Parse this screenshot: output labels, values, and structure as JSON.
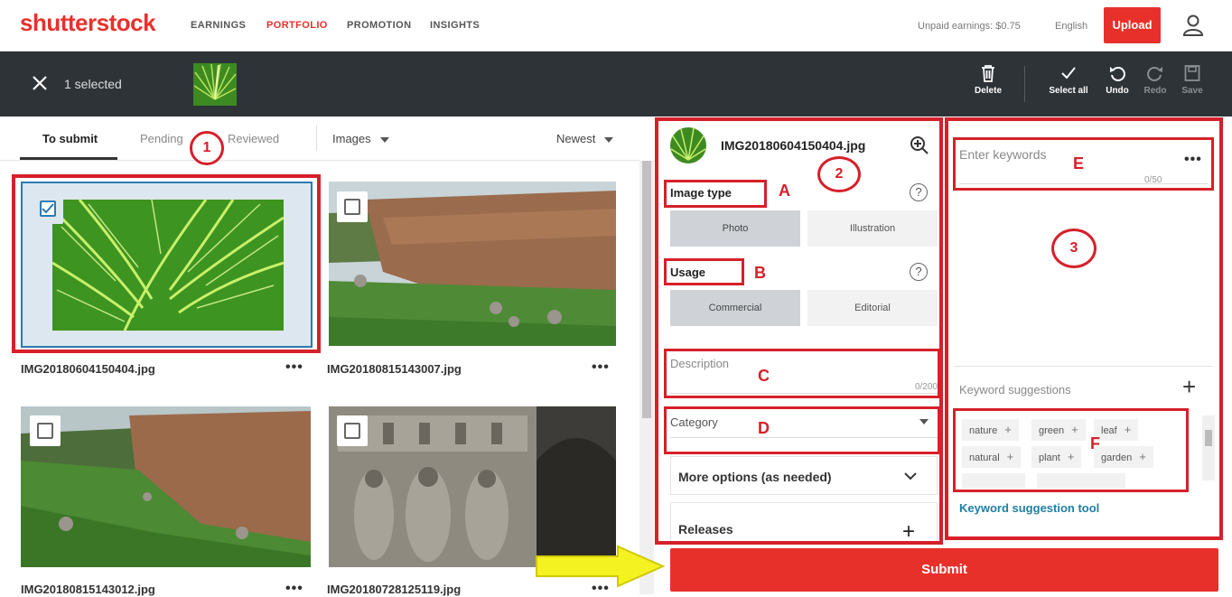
{
  "colors": {
    "brand": "#e8302b",
    "annotation": "#d6202a",
    "dark_bar": "#2e3338",
    "arrow": "#f5f222",
    "link": "#1f7fa4"
  },
  "nav": {
    "logo": "shutterstock",
    "links": [
      "EARNINGS",
      "PORTFOLIO",
      "PROMOTION",
      "INSIGHTS"
    ],
    "active": "PORTFOLIO",
    "unpaid": "Unpaid earnings: $0.75",
    "language": "English",
    "upload": "Upload"
  },
  "selection": {
    "count_label": "1 selected",
    "tools": {
      "delete": "Delete",
      "select_all": "Select all",
      "undo": "Undo",
      "redo": "Redo",
      "save": "Save"
    }
  },
  "tabs": {
    "items": [
      "To submit",
      "Pending",
      "Reviewed"
    ],
    "active": "To submit",
    "media_filter": "Images",
    "sort": "Newest"
  },
  "images": [
    {
      "filename": "IMG20180604150404.jpg",
      "selected": true
    },
    {
      "filename": "IMG20180815143007.jpg",
      "selected": false
    },
    {
      "filename": "IMG20180815143012.jpg",
      "selected": false
    },
    {
      "filename": "IMG20180728125119.jpg",
      "selected": false
    }
  ],
  "more_icon": "•••",
  "detail": {
    "filename": "IMG20180604150404.jpg",
    "image_type_label": "Image type",
    "image_type_options": [
      "Photo",
      "Illustration"
    ],
    "image_type_selected": "Photo",
    "usage_label": "Usage",
    "usage_options": [
      "Commercial",
      "Editorial"
    ],
    "usage_selected": "Commercial",
    "help_icon": "?",
    "description_placeholder": "Description",
    "description_counter": "0/200",
    "category_placeholder": "Category",
    "more_options": "More options (as needed)",
    "releases": "Releases",
    "plus": "+"
  },
  "keywords": {
    "placeholder": "Enter keywords",
    "counter": "0/50",
    "suggestions_label": "Keyword suggestions",
    "suggestions": [
      "nature",
      "green",
      "leaf",
      "natural",
      "plant",
      "garden"
    ],
    "tool_link": "Keyword suggestion tool"
  },
  "submit": "Submit",
  "annotations": {
    "circles": [
      "1",
      "2",
      "3"
    ],
    "letters": [
      "A",
      "B",
      "C",
      "D",
      "E",
      "F"
    ]
  }
}
